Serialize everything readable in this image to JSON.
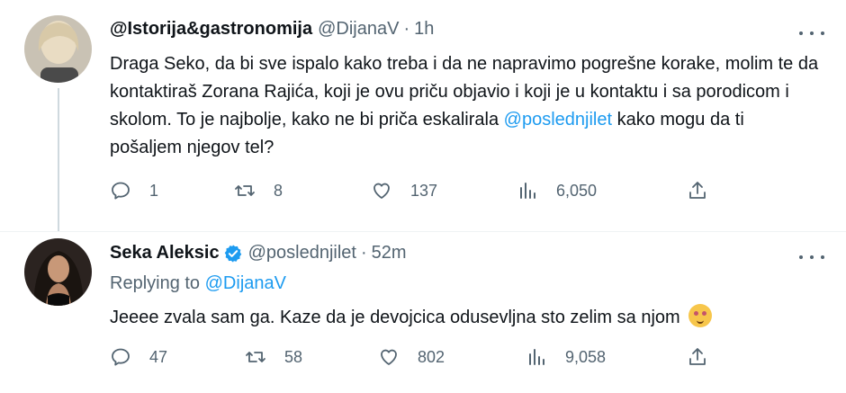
{
  "tweets": [
    {
      "display_name": "@Istorija&gastronomija",
      "handle": "@DijanaV",
      "separator": "·",
      "time": "1h",
      "text_before_mention": "Draga Seko, da bi sve ispalo kako treba i da ne napravimo pogrešne korake, molim te da kontaktiraš Zorana Rajića, koji je ovu priču objavio i koji je u kontaktu i sa porodicom i skolom. To je najbolje, kako ne bi priča eskalirala ",
      "mention": "@poslednjilet",
      "text_after_mention": " kako mogu da ti pošaljem njegov tel?",
      "replies": "1",
      "reposts": "8",
      "likes": "137",
      "views": "6,050"
    },
    {
      "display_name": "Seka Aleksic",
      "handle": "@poslednjilet",
      "separator": "·",
      "time": "52m",
      "replying_label": "Replying to ",
      "replying_handle": "@DijanaV",
      "text": "Jeeee zvala sam ga. Kaze da je devojcica odusevljna sto zelim sa njom ",
      "emoji": "smiling-face-with-heart-eyes-emoji",
      "replies": "47",
      "reposts": "58",
      "likes": "802",
      "views": "9,058"
    }
  ],
  "colors": {
    "text": "#0f1419",
    "secondary": "#536471",
    "link": "#1d9bf0",
    "verified": "#1d9bf0",
    "divider": "#eff3f4"
  },
  "icons": [
    "reply-icon",
    "repost-icon",
    "like-icon",
    "views-icon",
    "share-icon",
    "more-icon",
    "verified-badge-icon"
  ]
}
